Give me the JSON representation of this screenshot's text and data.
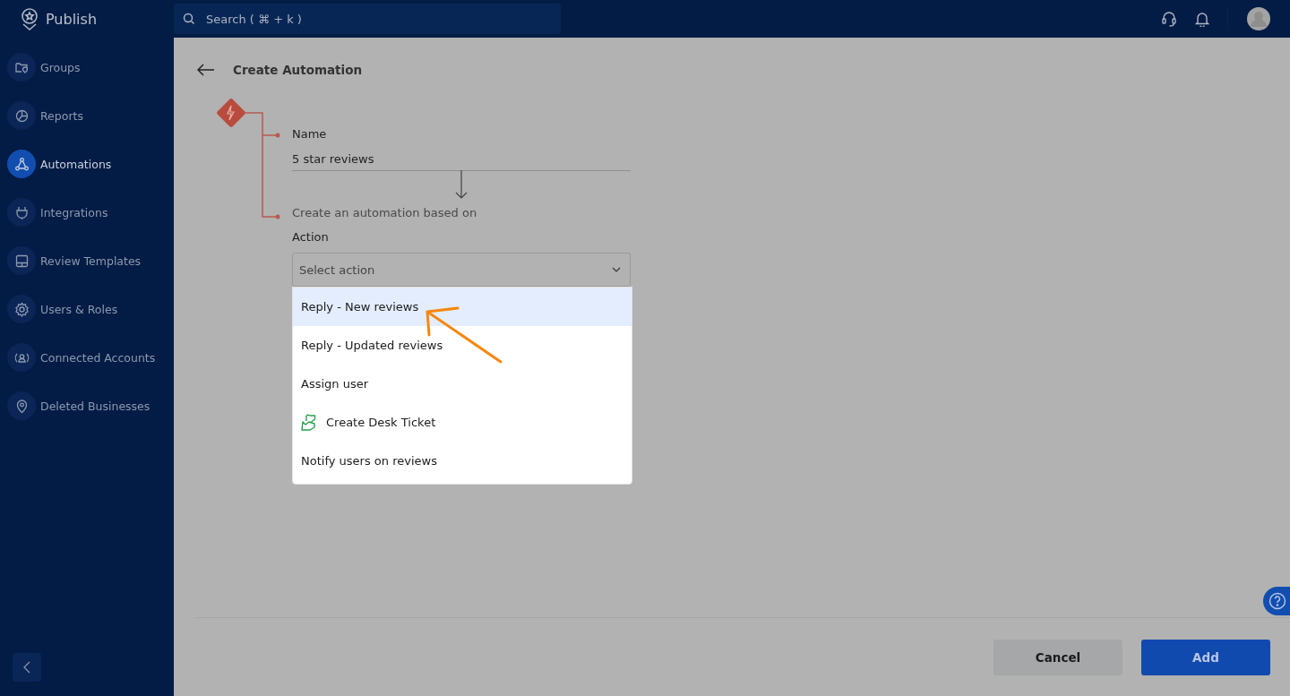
{
  "app": {
    "name": "Publish"
  },
  "search": {
    "placeholder": "Search ( ⌘ + k )"
  },
  "sidebar": {
    "items": [
      {
        "label": "Groups",
        "selected": false
      },
      {
        "label": "Reports",
        "selected": false
      },
      {
        "label": "Automations",
        "selected": true
      },
      {
        "label": "Integrations",
        "selected": false
      },
      {
        "label": "Review Templates",
        "selected": false
      },
      {
        "label": "Users & Roles",
        "selected": false
      },
      {
        "label": "Connected Accounts",
        "selected": false
      },
      {
        "label": "Deleted Businesses",
        "selected": false
      }
    ]
  },
  "page": {
    "title": "Create Automation"
  },
  "form": {
    "name_label": "Name",
    "name_value": "5 star reviews",
    "based_on_label": "Create an automation based on",
    "action_label": "Action",
    "action_placeholder": "Select action"
  },
  "dropdown": {
    "options": [
      {
        "label": "Reply - New reviews",
        "kind": "text",
        "selected": true
      },
      {
        "label": "Reply - Updated reviews",
        "kind": "text",
        "selected": false
      },
      {
        "label": "Assign user",
        "kind": "text",
        "selected": false
      },
      {
        "label": "Create Desk Ticket",
        "kind": "icon",
        "selected": false
      },
      {
        "label": "Notify users on reviews",
        "kind": "text",
        "selected": false
      }
    ]
  },
  "footer": {
    "buttons": [
      {
        "label": "Cancel",
        "kind": "secondary"
      },
      {
        "label": "Add",
        "kind": "primary"
      }
    ]
  }
}
